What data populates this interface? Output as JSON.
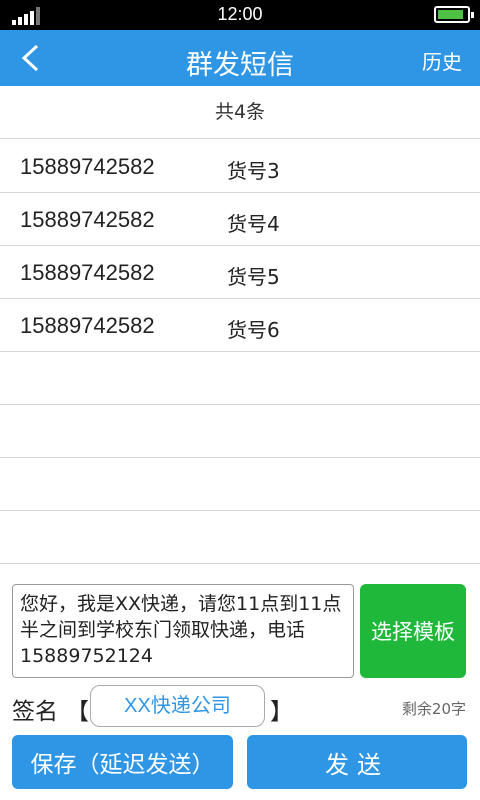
{
  "status_bar": {
    "time": "12:00"
  },
  "header": {
    "title": "群发短信",
    "history_label": "历史",
    "back_icon": "chevron-left-icon"
  },
  "count_label": "共4条",
  "recipients": [
    {
      "phone": "15889742582",
      "goods": "货号3"
    },
    {
      "phone": "15889742582",
      "goods": "货号4"
    },
    {
      "phone": "15889742582",
      "goods": "货号5"
    },
    {
      "phone": "15889742582",
      "goods": "货号6"
    }
  ],
  "message": {
    "text": "您好，我是XX快递，请您11点到11点半之间到学校东门领取快递，电话15889752124"
  },
  "template_button_label": "选择模板",
  "signature": {
    "label": "签名",
    "open_bracket": "【",
    "value": "XX快递公司",
    "close_bracket": "】",
    "remaining": "剩余20字"
  },
  "actions": {
    "save_label": "保存（延迟发送）",
    "send_label": "发送"
  },
  "colors": {
    "primary": "#2f96e6",
    "template_green": "#1fb83a",
    "battery": "#4ec043"
  }
}
